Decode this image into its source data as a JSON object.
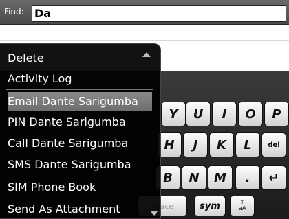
{
  "find_bar": {
    "label": "Find:",
    "value": "Da"
  },
  "background": {
    "ghost_line_1": "D",
    "ghost_line_2": "umba"
  },
  "menu": {
    "items": [
      {
        "label": "Delete",
        "selected": false
      },
      {
        "label": "Activity Log",
        "selected": false
      },
      {
        "label": "Email Dante Sarigumba",
        "selected": true
      },
      {
        "label": "PIN Dante Sarigumba",
        "selected": false
      },
      {
        "label": "Call Dante Sarigumba",
        "selected": false
      },
      {
        "label": "SMS Dante Sarigumba",
        "selected": false
      },
      {
        "label": "SIM Phone Book",
        "selected": false
      },
      {
        "label": "Send As Attachment",
        "selected": false
      }
    ]
  },
  "keyboard": {
    "row1": [
      "Y",
      "U",
      "I",
      "O",
      "P"
    ],
    "row2": [
      "H",
      "J",
      "K",
      "L",
      "del"
    ],
    "row3": [
      "B",
      "N",
      "M",
      ".",
      "↵"
    ],
    "space": "space",
    "sym": "sym",
    "shift_top": "⇧",
    "shift_bottom": "aA"
  }
}
